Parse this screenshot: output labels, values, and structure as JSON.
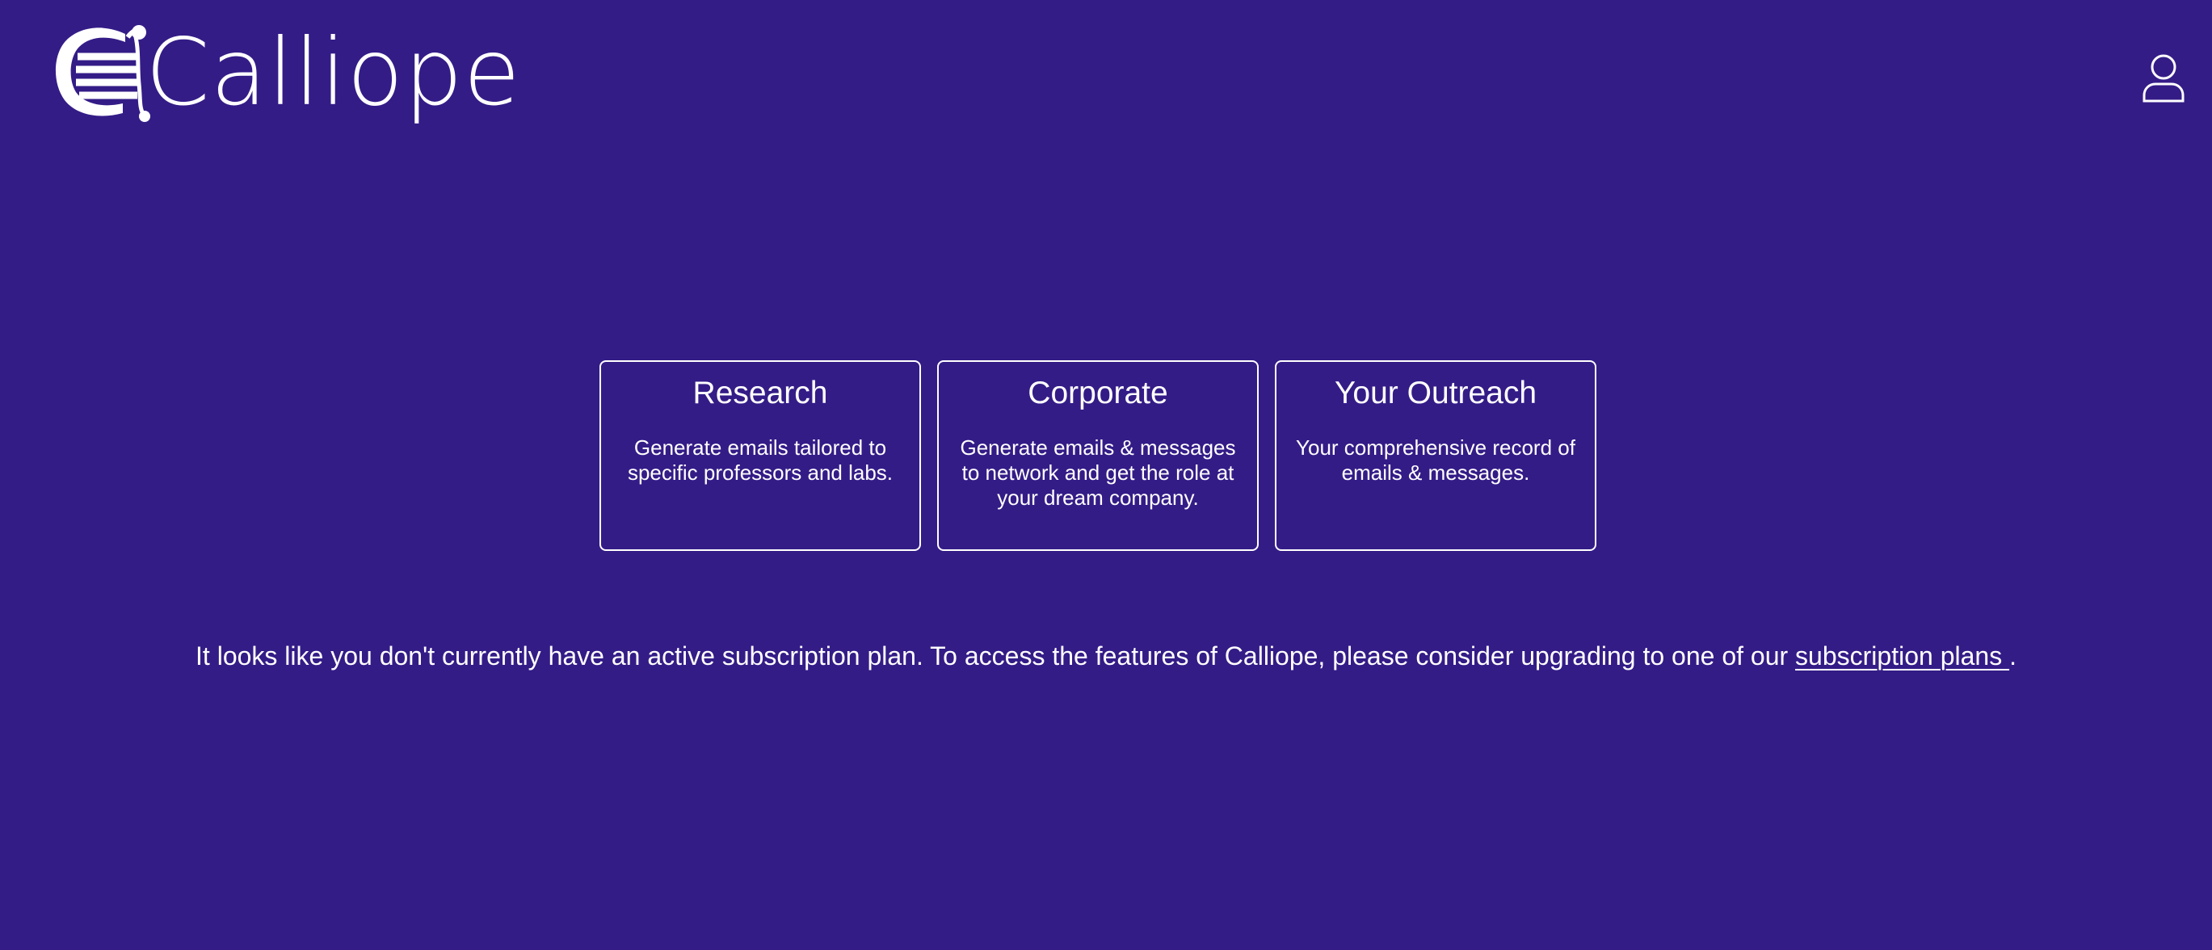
{
  "header": {
    "brand_name": "Calliope",
    "logo_icon": "lyre-icon",
    "user_icon": "user-icon"
  },
  "cards": [
    {
      "title": "Research",
      "description": "Generate emails tailored to specific professors and labs."
    },
    {
      "title": "Corporate",
      "description": "Generate emails & messages to network and get the role at your dream company."
    },
    {
      "title": "Your Outreach",
      "description": "Your comprehensive record of emails & messages."
    }
  ],
  "notice": {
    "text": "It looks like you don't currently have an active subscription plan. To access the features of Calliope, please consider upgrading to one of our ",
    "link_label": "subscription plans ",
    "suffix": "."
  },
  "colors": {
    "background": "#341c87",
    "foreground": "#ffffff"
  }
}
